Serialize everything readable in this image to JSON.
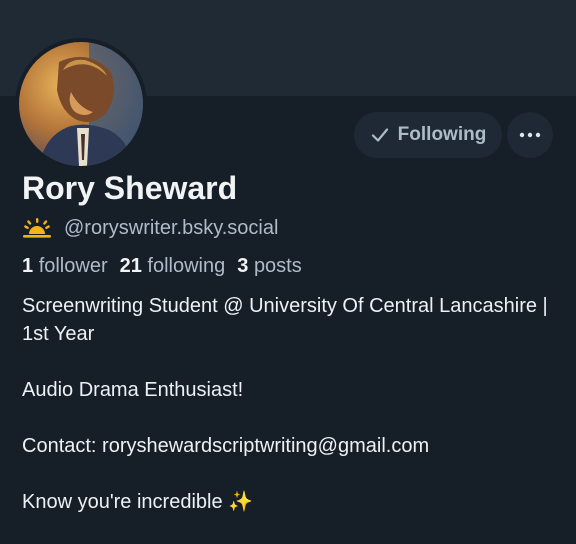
{
  "profile": {
    "display_name": "Rory Sheward",
    "handle": "@roryswriter.bsky.social",
    "handle_emoji": "sunrise-icon",
    "avatar": "avatar"
  },
  "actions": {
    "following_label": "Following",
    "more_icon": "ellipsis-icon"
  },
  "stats": {
    "followers_count": "1",
    "followers_label": "follower",
    "following_count": "21",
    "following_label": "following",
    "posts_count": "3",
    "posts_label": "posts"
  },
  "bio": {
    "line1": "Screenwriting Student @ University Of Central Lancashire | 1st Year",
    "line2": "Audio Drama Enthusiast!",
    "line3_prefix": "Contact: ",
    "line3_email": "roryshewardscriptwriting@gmail.com",
    "line4": "Know you're incredible ✨"
  },
  "colors": {
    "background": "#161e27",
    "banner": "#1f2a35",
    "button_bg": "#1e2935",
    "muted_text": "#aebbc9",
    "primary_text": "#f1f3f5"
  }
}
